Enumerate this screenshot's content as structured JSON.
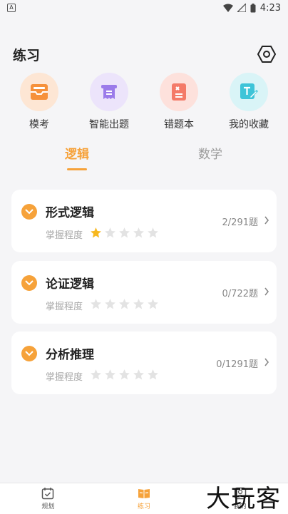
{
  "status_bar": {
    "app_badge": "A",
    "time": "4:23"
  },
  "header": {
    "title": "练习"
  },
  "quick_actions": [
    {
      "label": "模考",
      "icon": "inbox-icon",
      "bg": "#fde6d4",
      "fg": "#f6913a"
    },
    {
      "label": "智能出题",
      "icon": "receipt-icon",
      "bg": "#ece4fb",
      "fg": "#9b7bea"
    },
    {
      "label": "错题本",
      "icon": "mistake-book-icon",
      "bg": "#fde1dc",
      "fg": "#f47a68"
    },
    {
      "label": "我的收藏",
      "icon": "note-edit-icon",
      "bg": "#d9f4f7",
      "fg": "#3ec4d8"
    }
  ],
  "tabs": [
    {
      "label": "逻辑",
      "active": true
    },
    {
      "label": "数学",
      "active": false
    }
  ],
  "cards": [
    {
      "title": "形式逻辑",
      "mastery_label": "掌握程度",
      "stars_filled": 1,
      "stars_total": 5,
      "progress": "2/291题"
    },
    {
      "title": "论证逻辑",
      "mastery_label": "掌握程度",
      "stars_filled": 0,
      "stars_total": 5,
      "progress": "0/722题"
    },
    {
      "title": "分析推理",
      "mastery_label": "掌握程度",
      "stars_filled": 0,
      "stars_total": 5,
      "progress": "0/1291题"
    }
  ],
  "bottom_nav": [
    {
      "label": "规划",
      "icon": "calendar-check-icon",
      "active": false
    },
    {
      "label": "练习",
      "icon": "book-icon",
      "active": true
    },
    {
      "label": "我的",
      "icon": "profile-icon",
      "active": false
    }
  ],
  "watermark": "大玩客",
  "colors": {
    "accent": "#f6a23a",
    "background": "#f5f5f7",
    "star_filled": "#f7b81f",
    "star_empty": "#e3e3e3"
  }
}
